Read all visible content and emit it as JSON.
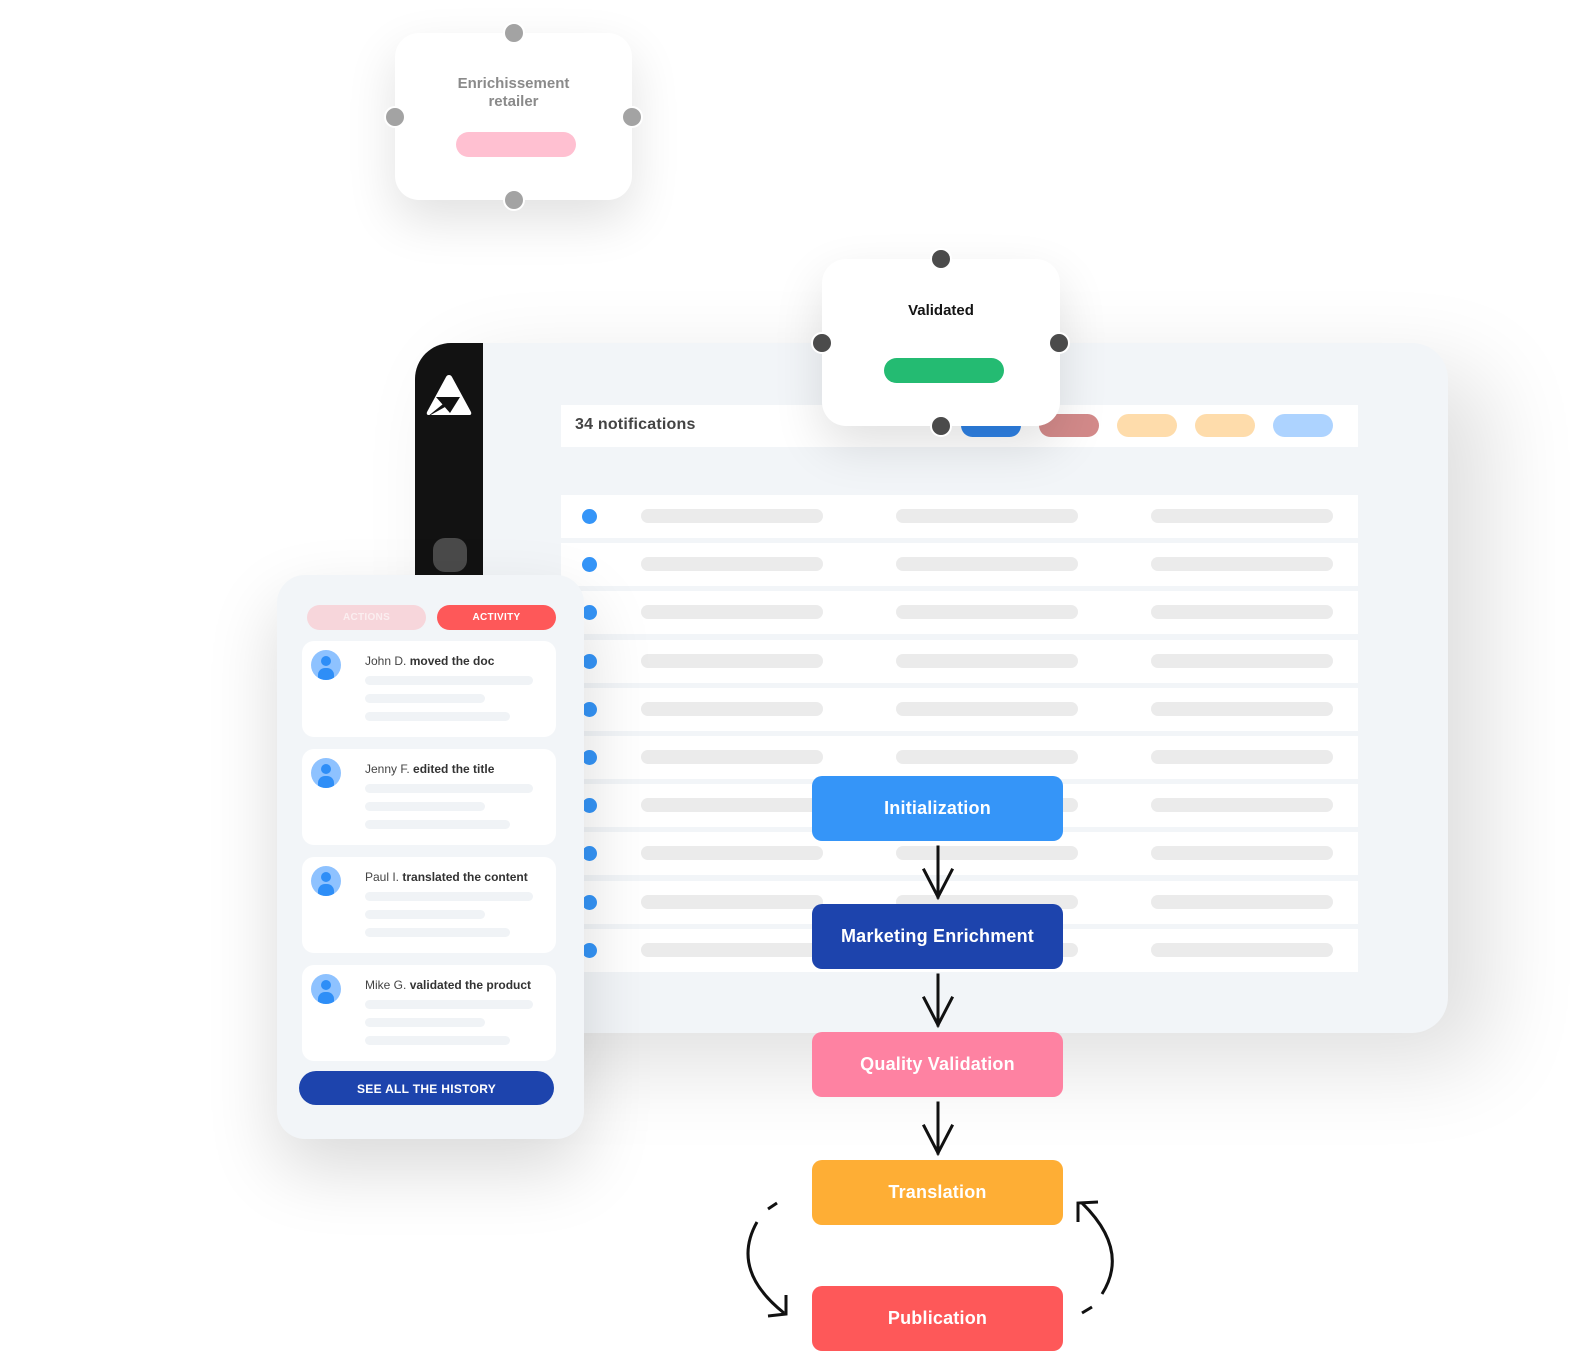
{
  "colors": {
    "sidebar_bg": "#121212",
    "window_bg": "#f2f5f8",
    "row_dot": "#3595f8",
    "placeholder_bar": "#ebebeb",
    "enrich_badge": "#ffc0d1",
    "validated_badge": "#24bb72",
    "history_button": "#1d44ad",
    "tab_active": "#fe5859",
    "tab_inactive": "#f7d6db"
  },
  "app": {
    "logo_icon": "triangle-logo-icon",
    "notifications": {
      "title": "34 notifications",
      "filter_pills": [
        {
          "name": "blue",
          "color": "#2e82e6"
        },
        {
          "name": "red",
          "color": "#d38a8a"
        },
        {
          "name": "orange",
          "color": "#fedcab"
        },
        {
          "name": "orange-2",
          "color": "#fedcab"
        },
        {
          "name": "light-blue",
          "color": "#add3ff"
        }
      ]
    },
    "rows_count": 10
  },
  "nodes": {
    "enrichissement": {
      "title_line1": "Enrichissement",
      "title_line2": "retailer",
      "handle_color": "#a3a3a3"
    },
    "validated": {
      "title": "Validated",
      "handle_color": "#4b4b4b"
    }
  },
  "activity": {
    "tabs": [
      {
        "label": "ACTIONS",
        "active": false
      },
      {
        "label": "ACTIVITY",
        "active": true
      }
    ],
    "items": [
      {
        "name": "John D.",
        "action": "moved the doc"
      },
      {
        "name": "Jenny F.",
        "action": "edited the title"
      },
      {
        "name": "Paul I.",
        "action": "translated the content"
      },
      {
        "name": "Mike G.",
        "action": "validated the product"
      }
    ],
    "history_button": "SEE ALL THE HISTORY"
  },
  "workflow": {
    "steps": [
      {
        "label": "Initialization",
        "color": "#3595f8"
      },
      {
        "label": "Marketing Enrichment",
        "color": "#1d44ad"
      },
      {
        "label": "Quality Validation",
        "color": "#fe82a2"
      },
      {
        "label": "Translation",
        "color": "#feae35"
      },
      {
        "label": "Publication",
        "color": "#fe5859"
      }
    ],
    "loop": "Translation <-> Publication"
  }
}
